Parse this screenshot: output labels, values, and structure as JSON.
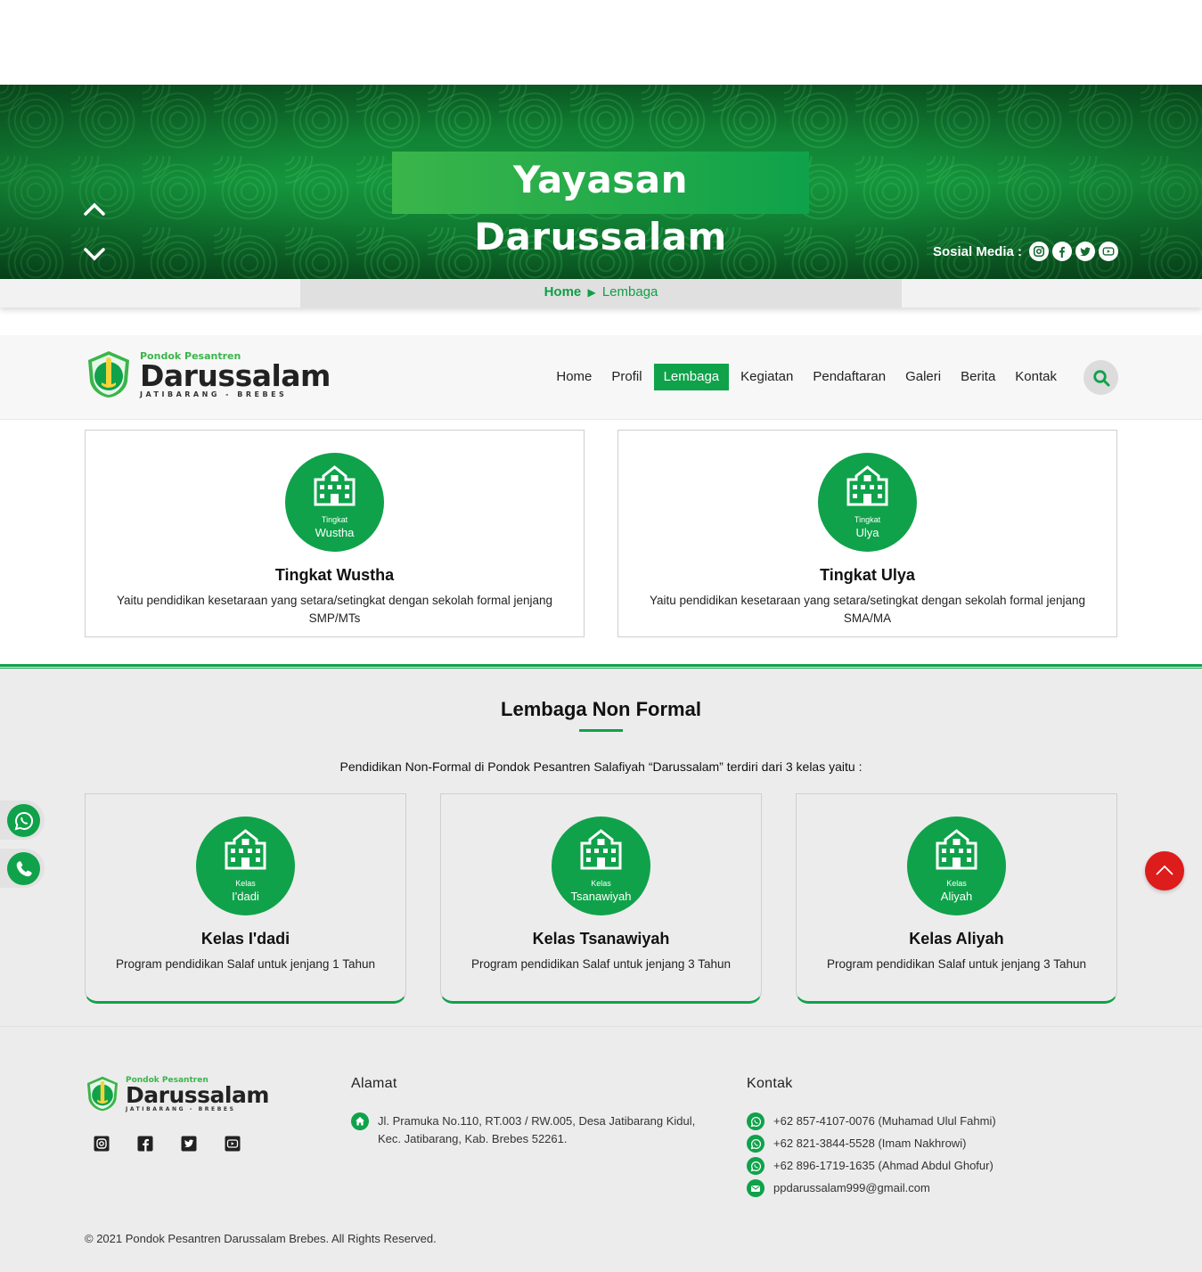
{
  "hero": {
    "title": "Yayasan Darussalam",
    "social_label": "Sosial Media :",
    "social_icons": [
      "instagram-icon",
      "facebook-icon",
      "twitter-icon",
      "youtube-icon"
    ]
  },
  "breadcrumb": {
    "home": "Home",
    "separator": "▶",
    "current": "Lembaga"
  },
  "logo": {
    "small": "Pondok Pesantren",
    "big": "Darussalam",
    "sub": "JATIBARANG - BREBES"
  },
  "nav": {
    "items": [
      {
        "label": "Home",
        "active": false
      },
      {
        "label": "Profil",
        "active": false
      },
      {
        "label": "Lembaga",
        "active": true
      },
      {
        "label": "Kegiatan",
        "active": false
      },
      {
        "label": "Pendaftaran",
        "active": false
      },
      {
        "label": "Galeri",
        "active": false
      },
      {
        "label": "Berita",
        "active": false
      },
      {
        "label": "Kontak",
        "active": false
      }
    ]
  },
  "formal": [
    {
      "badge_top": "Tingkat",
      "badge_bottom": "Wustha",
      "title": "Tingkat Wustha",
      "desc": "Yaitu pendidikan kesetaraan yang setara/setingkat dengan sekolah formal jenjang SMP/MTs"
    },
    {
      "badge_top": "Tingkat",
      "badge_bottom": "Ulya",
      "title": "Tingkat Ulya",
      "desc": "Yaitu pendidikan kesetaraan yang setara/setingkat dengan sekolah formal jenjang SMA/MA"
    }
  ],
  "nonformal": {
    "title": "Lembaga Non Formal",
    "intro": "Pendidikan Non-Formal di Pondok Pesantren Salafiyah “Darussalam” terdiri dari 3 kelas yaitu :",
    "cards": [
      {
        "badge_top": "Kelas",
        "badge_bottom": "I'dadi",
        "title": "Kelas I'dadi",
        "desc": "Program pendidikan Salaf untuk jenjang 1 Tahun"
      },
      {
        "badge_top": "Kelas",
        "badge_bottom": "Tsanawiyah",
        "title": "Kelas Tsanawiyah",
        "desc": "Program pendidikan Salaf untuk jenjang 3 Tahun"
      },
      {
        "badge_top": "Kelas",
        "badge_bottom": "Aliyah",
        "title": "Kelas Aliyah",
        "desc": "Program pendidikan Salaf untuk jenjang 3 Tahun"
      }
    ]
  },
  "footer": {
    "alamat_heading": "Alamat",
    "alamat": "Jl. Pramuka No.110, RT.003 / RW.005, Desa Jatibarang Kidul, Kec. Jatibarang, Kab. Brebes 52261.",
    "kontak_heading": "Kontak",
    "contacts": [
      "+62 857-4107-0076 (Muhamad Ulul Fahmi)",
      "+62 821-3844-5528 (Imam Nakhrowi)",
      "+62 896-1719-1635 (Ahmad Abdul Ghofur)",
      "ppdarussalam999@gmail.com"
    ],
    "copyright": "© 2021 Pondok Pesantren Darussalam Brebes. All Rights Reserved."
  },
  "colors": {
    "brand_green": "#0fa24a",
    "light_green": "#3ab54a",
    "scroll_top_red": "#dd1c1c"
  }
}
